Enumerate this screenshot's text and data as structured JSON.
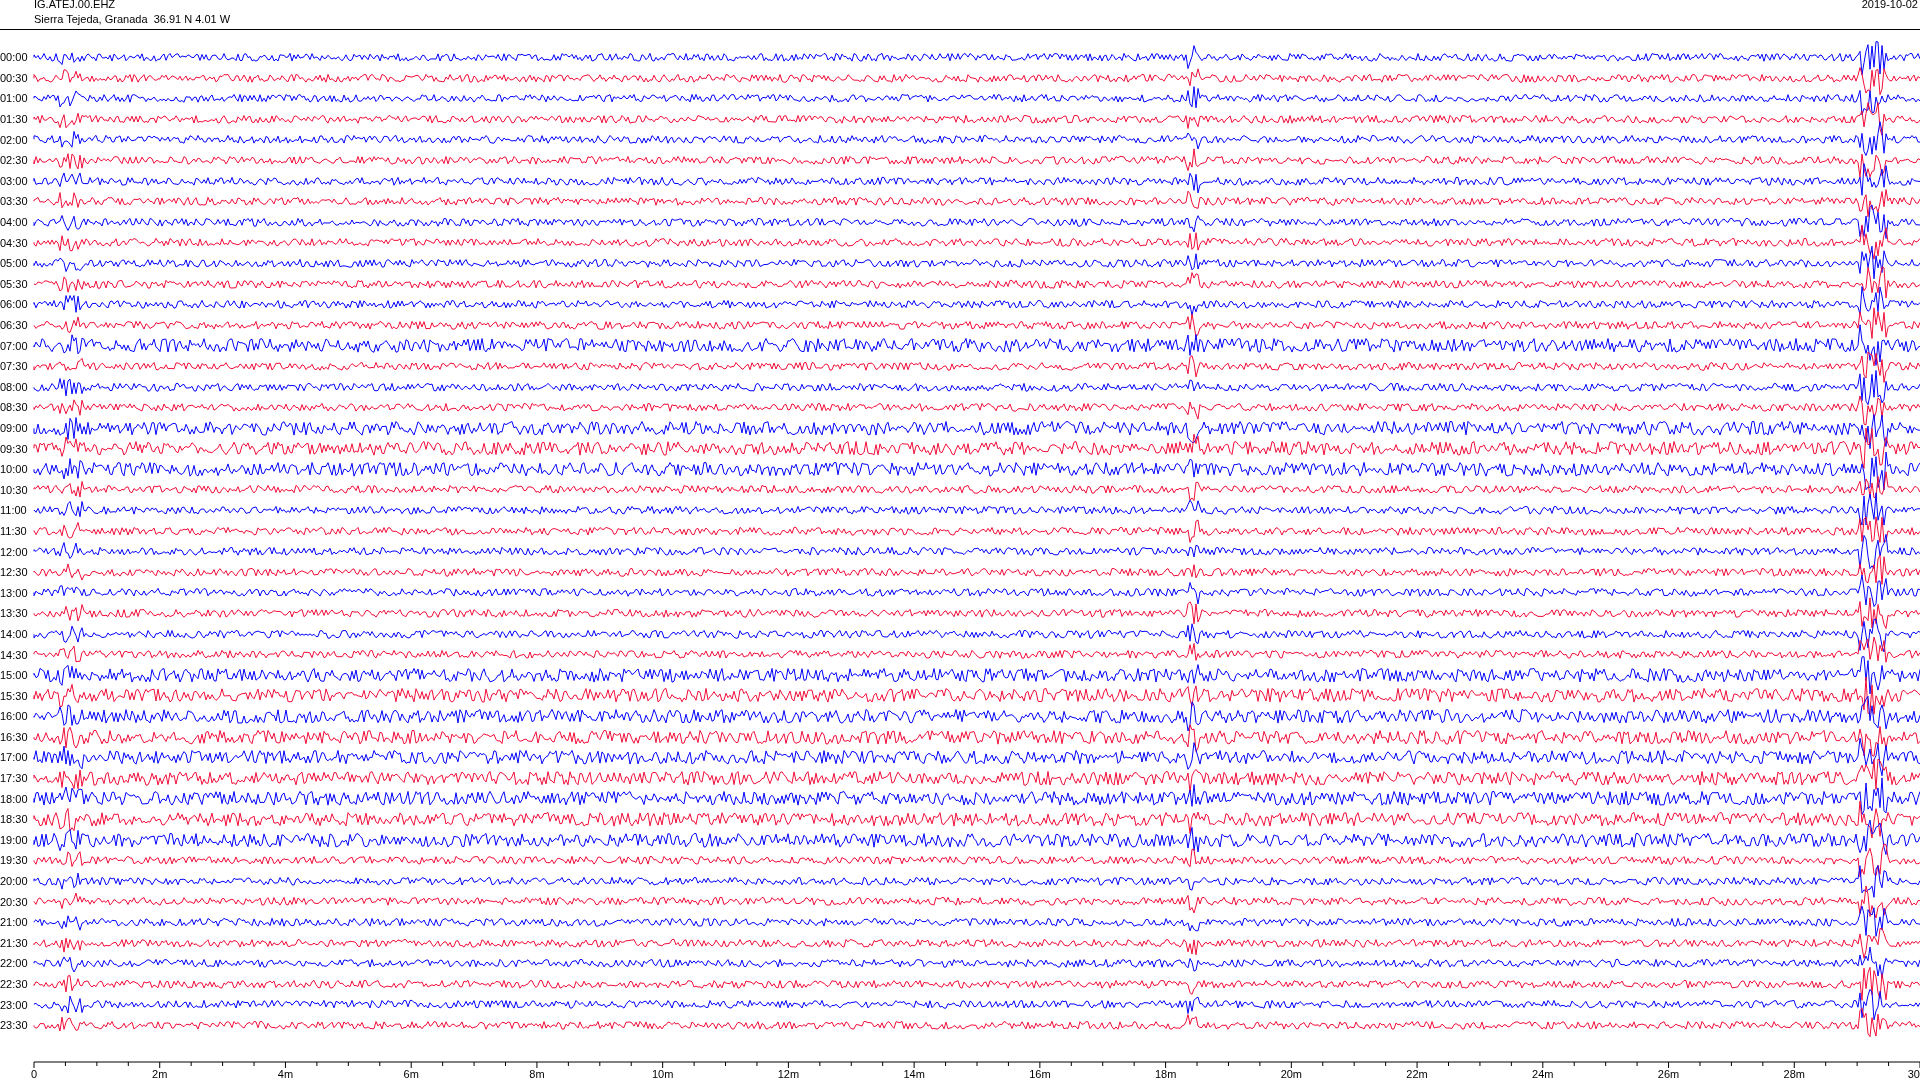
{
  "header": {
    "station": "IG.ATEJ.00.EHZ",
    "location": "Sierra Tejeda, Granada  36.91 N 4.01 W",
    "date": "2019-10-02"
  },
  "rows": [
    {
      "label": "00:00",
      "color": "#0000ff"
    },
    {
      "label": "00:30",
      "color": "#f20a37"
    },
    {
      "label": "01:00",
      "color": "#0000ff"
    },
    {
      "label": "01:30",
      "color": "#f20a37"
    },
    {
      "label": "02:00",
      "color": "#0000ff"
    },
    {
      "label": "02:30",
      "color": "#f20a37"
    },
    {
      "label": "03:00",
      "color": "#0000ff"
    },
    {
      "label": "03:30",
      "color": "#f20a37"
    },
    {
      "label": "04:00",
      "color": "#0000ff"
    },
    {
      "label": "04:30",
      "color": "#f20a37"
    },
    {
      "label": "05:00",
      "color": "#0000ff"
    },
    {
      "label": "05:30",
      "color": "#f20a37"
    },
    {
      "label": "06:00",
      "color": "#0000ff"
    },
    {
      "label": "06:30",
      "color": "#f20a37"
    },
    {
      "label": "07:00",
      "color": "#0000ff"
    },
    {
      "label": "07:30",
      "color": "#f20a37"
    },
    {
      "label": "08:00",
      "color": "#0000ff"
    },
    {
      "label": "08:30",
      "color": "#f20a37"
    },
    {
      "label": "09:00",
      "color": "#0000ff"
    },
    {
      "label": "09:30",
      "color": "#f20a37"
    },
    {
      "label": "10:00",
      "color": "#0000ff"
    },
    {
      "label": "10:30",
      "color": "#f20a37"
    },
    {
      "label": "11:00",
      "color": "#0000ff"
    },
    {
      "label": "11:30",
      "color": "#f20a37"
    },
    {
      "label": "12:00",
      "color": "#0000ff"
    },
    {
      "label": "12:30",
      "color": "#f20a37"
    },
    {
      "label": "13:00",
      "color": "#0000ff"
    },
    {
      "label": "13:30",
      "color": "#f20a37"
    },
    {
      "label": "14:00",
      "color": "#0000ff"
    },
    {
      "label": "14:30",
      "color": "#f20a37"
    },
    {
      "label": "15:00",
      "color": "#0000ff"
    },
    {
      "label": "15:30",
      "color": "#f20a37"
    },
    {
      "label": "16:00",
      "color": "#0000ff"
    },
    {
      "label": "16:30",
      "color": "#f20a37"
    },
    {
      "label": "17:00",
      "color": "#0000ff"
    },
    {
      "label": "17:30",
      "color": "#f20a37"
    },
    {
      "label": "18:00",
      "color": "#0000ff"
    },
    {
      "label": "18:30",
      "color": "#f20a37"
    },
    {
      "label": "19:00",
      "color": "#0000ff"
    },
    {
      "label": "19:30",
      "color": "#f20a37"
    },
    {
      "label": "20:00",
      "color": "#0000ff"
    },
    {
      "label": "20:30",
      "color": "#f20a37"
    },
    {
      "label": "21:00",
      "color": "#0000ff"
    },
    {
      "label": "21:30",
      "color": "#f20a37"
    },
    {
      "label": "22:00",
      "color": "#0000ff"
    },
    {
      "label": "22:30",
      "color": "#f20a37"
    },
    {
      "label": "23:00",
      "color": "#0000ff"
    },
    {
      "label": "23:30",
      "color": "#f20a37"
    }
  ],
  "x_axis": {
    "labels": [
      "0",
      "2m",
      "4m",
      "6m",
      "8m",
      "10m",
      "12m",
      "14m",
      "16m",
      "18m",
      "20m",
      "22m",
      "24m",
      "26m",
      "28m",
      "30"
    ]
  }
}
